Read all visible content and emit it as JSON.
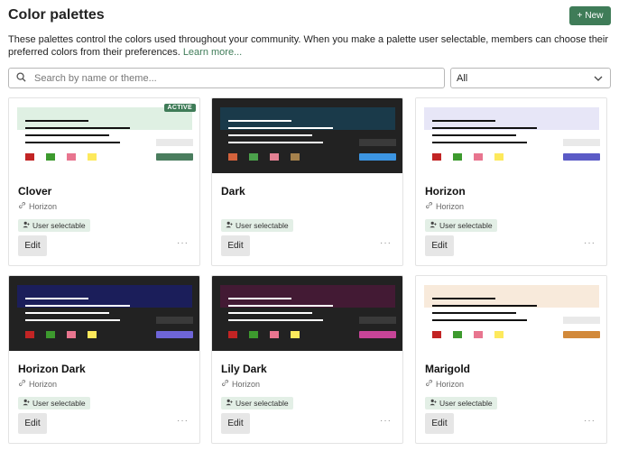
{
  "header": {
    "title": "Color palettes",
    "new_label": "New",
    "new_icon": "plus-icon",
    "new_color": "#3f7c58"
  },
  "description": {
    "text": "These palettes control the colors used throughout your community. When you make a palette user selectable, members can choose their preferred colors from their preferences.",
    "link": "Learn more..."
  },
  "search": {
    "placeholder": "Search by name or theme...",
    "icon": "search-icon"
  },
  "filter": {
    "selected": "All",
    "icon": "chevron-down-icon"
  },
  "labels": {
    "edit": "Edit",
    "user_selectable": "User selectable",
    "active": "ACTIVE",
    "more": "···"
  },
  "palettes": [
    {
      "name": "Clover",
      "base": "Horizon",
      "active": true,
      "bg": "#ffffff",
      "band": "#dff0e3",
      "text": "#111111",
      "box": "#e9e9e9",
      "primary": "#4a7d5e",
      "swatches": [
        "#c22424",
        "#3d9a2e",
        "#e8758f",
        "#fde95c"
      ]
    },
    {
      "name": "Dark",
      "base": "",
      "active": false,
      "bg": "#222222",
      "band": "#1a3a4a",
      "text": "#ffffff",
      "box": "#3a3a3a",
      "primary": "#3c95e2",
      "swatches": [
        "#d3623c",
        "#4ba14b",
        "#e38193",
        "#a5814c"
      ]
    },
    {
      "name": "Horizon",
      "base": "Horizon",
      "active": false,
      "bg": "#ffffff",
      "band": "#e7e6f7",
      "text": "#111111",
      "box": "#e9e9e9",
      "primary": "#5b5bc6",
      "swatches": [
        "#c22424",
        "#3d9a2e",
        "#e8758f",
        "#fde95c"
      ]
    },
    {
      "name": "Horizon Dark",
      "base": "Horizon",
      "active": false,
      "bg": "#222222",
      "band": "#1b1e5a",
      "text": "#ffffff",
      "box": "#3a3a3a",
      "primary": "#6e65d8",
      "swatches": [
        "#c22424",
        "#3d9a2e",
        "#e8758f",
        "#fde95c"
      ]
    },
    {
      "name": "Lily Dark",
      "base": "Horizon",
      "active": false,
      "bg": "#222222",
      "band": "#431a34",
      "text": "#ffffff",
      "box": "#3a3a3a",
      "primary": "#c74498",
      "swatches": [
        "#c22424",
        "#3d9a2e",
        "#e8758f",
        "#fde95c"
      ]
    },
    {
      "name": "Marigold",
      "base": "Horizon",
      "active": false,
      "bg": "#ffffff",
      "band": "#f8eadb",
      "text": "#111111",
      "box": "#e9e9e9",
      "primary": "#d2893a",
      "swatches": [
        "#c22424",
        "#3d9a2e",
        "#e8758f",
        "#fde95c"
      ]
    }
  ]
}
